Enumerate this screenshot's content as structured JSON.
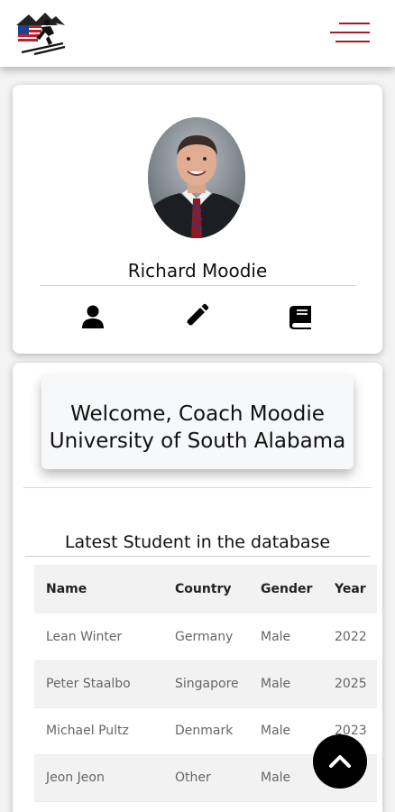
{
  "header": {
    "logo": "skier-flag-logo",
    "menu_icon": "hamburger-menu-icon",
    "accent_color": "#a01c2a"
  },
  "profile": {
    "name": "Richard Moodie",
    "actions": [
      {
        "icon": "user-icon"
      },
      {
        "icon": "pencil-icon"
      },
      {
        "icon": "book-icon"
      }
    ]
  },
  "welcome": {
    "line1": "Welcome, Coach Moodie",
    "line2": "University of South Alabama"
  },
  "students": {
    "title": "Latest Student in the database",
    "columns": [
      "Name",
      "Country",
      "Gender",
      "Year"
    ],
    "rows": [
      {
        "name": "Lean Winter",
        "country": "Germany",
        "gender": "Male",
        "year": "2022"
      },
      {
        "name": "Peter Staalbo",
        "country": "Singapore",
        "gender": "Male",
        "year": "2025"
      },
      {
        "name": "Michael Pultz",
        "country": "Denmark",
        "gender": "Male",
        "year": "2023"
      },
      {
        "name": "Jeon Jeon",
        "country": "Other",
        "gender": "Male",
        "year": ""
      }
    ]
  },
  "scroll_top": {
    "icon": "chevron-up-icon"
  }
}
